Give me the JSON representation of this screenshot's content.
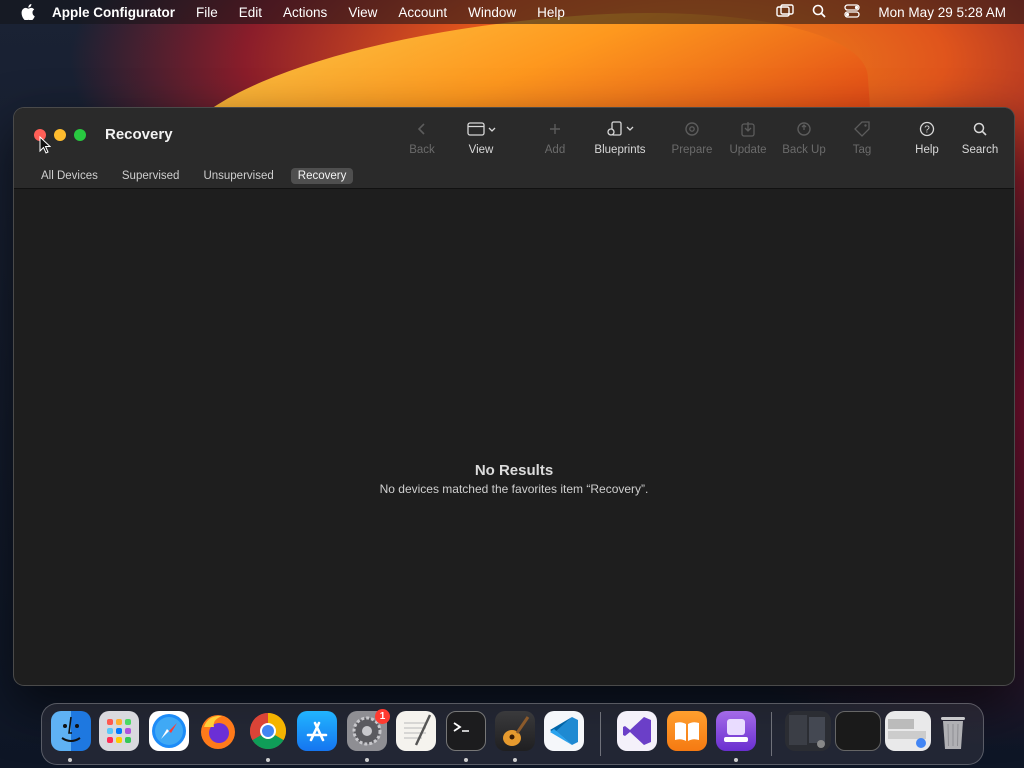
{
  "menubar": {
    "app_name": "Apple Configurator",
    "items": [
      "File",
      "Edit",
      "Actions",
      "View",
      "Account",
      "Window",
      "Help"
    ],
    "clock": "Mon May 29  5:28 AM"
  },
  "window": {
    "title": "Recovery",
    "toolbar": {
      "back": "Back",
      "view": "View",
      "add": "Add",
      "blueprints": "Blueprints",
      "prepare": "Prepare",
      "update": "Update",
      "back_up": "Back Up",
      "tag": "Tag",
      "help": "Help",
      "search": "Search"
    },
    "tabs": [
      "All Devices",
      "Supervised",
      "Unsupervised",
      "Recovery"
    ],
    "active_tab": "Recovery",
    "empty_state": {
      "title": "No Results",
      "message": "No devices matched the favorites item “Recovery”."
    }
  },
  "dock": {
    "apps": [
      "Finder",
      "Launchpad",
      "Safari",
      "Firefox",
      "Chrome",
      "App Store",
      "System Settings",
      "TextEdit",
      "Terminal",
      "GarageBand",
      "Visual Studio Code",
      "Visual Studio",
      "Books",
      "Apple Configurator"
    ],
    "system_settings_badge": "1"
  }
}
